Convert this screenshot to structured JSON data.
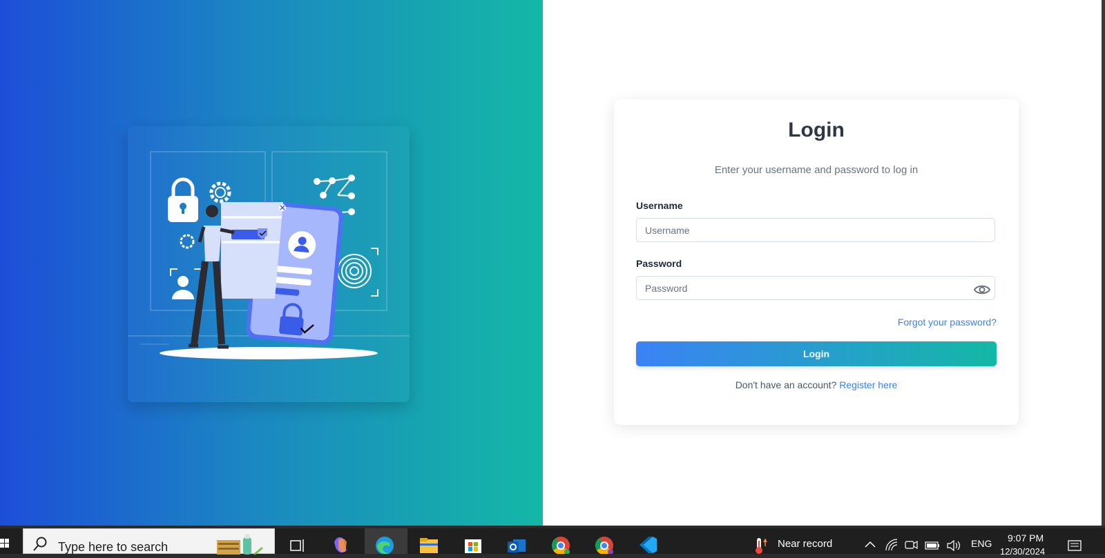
{
  "login": {
    "title": "Login",
    "subtitle": "Enter your username and password to log in",
    "username_label": "Username",
    "username_placeholder": "Username",
    "password_label": "Password",
    "password_placeholder": "Password",
    "forgot_link": "Forgot your password?",
    "login_button": "Login",
    "register_prompt": "Don't have an account?",
    "register_link": "Register here"
  },
  "colors": {
    "gradient_start": "#1d4ed8",
    "gradient_end": "#14b8a6",
    "link": "#3b82f6",
    "title": "#2d3748"
  },
  "taskbar": {
    "search_placeholder": "Type here to search",
    "weather": "Near record",
    "language": "ENG",
    "time": "9:07 PM",
    "date": "12/30/2024",
    "pinned": [
      "task-view-icon",
      "copilot-icon",
      "edge-icon",
      "file-explorer-icon",
      "store-icon",
      "outlook-icon",
      "chrome-icon",
      "chrome-profile-icon",
      "vscode-icon"
    ]
  }
}
